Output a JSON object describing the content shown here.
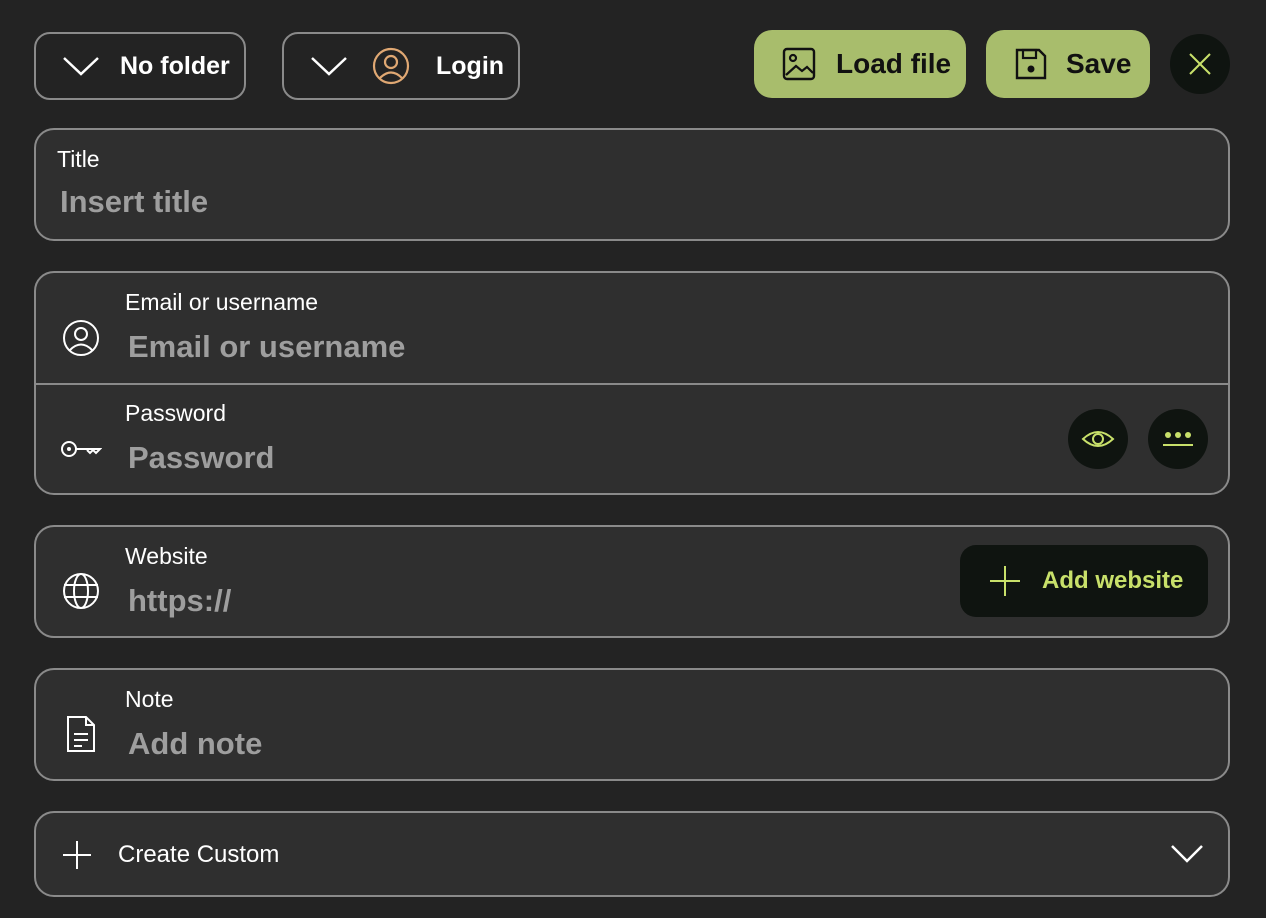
{
  "toolbar": {
    "folder_label": "No folder",
    "type_label": "Login",
    "load_file_label": "Load file",
    "save_label": "Save"
  },
  "title_field": {
    "label": "Title",
    "placeholder": "Insert title"
  },
  "credentials": {
    "username_label": "Email or username",
    "username_placeholder": "Email or username",
    "password_label": "Password",
    "password_placeholder": "Password"
  },
  "website": {
    "label": "Website",
    "placeholder": "https://",
    "add_label": "Add website"
  },
  "note": {
    "label": "Note",
    "placeholder": "Add note"
  },
  "custom": {
    "label": "Create Custom"
  },
  "icons": {
    "folder_dropdown": "chevron-down-icon",
    "type": "user-icon",
    "load_file": "image-icon",
    "save": "floppy-disk-icon",
    "close": "close-icon",
    "username": "user-icon",
    "password": "key-icon",
    "show_password": "eye-icon",
    "generate_password": "dots-icon",
    "website": "globe-icon",
    "add_website": "plus-icon",
    "note": "document-icon",
    "custom": "plus-icon",
    "custom_expand": "chevron-down-icon"
  },
  "colors": {
    "background": "#232323",
    "card": "#2f2f2f",
    "border": "#8a8a8a",
    "accent": "#a8bd6c",
    "accent_text": "#c8e06a",
    "user_icon": "#e0a873",
    "placeholder": "#9e9e9e",
    "dark_button": "#0f1410"
  }
}
